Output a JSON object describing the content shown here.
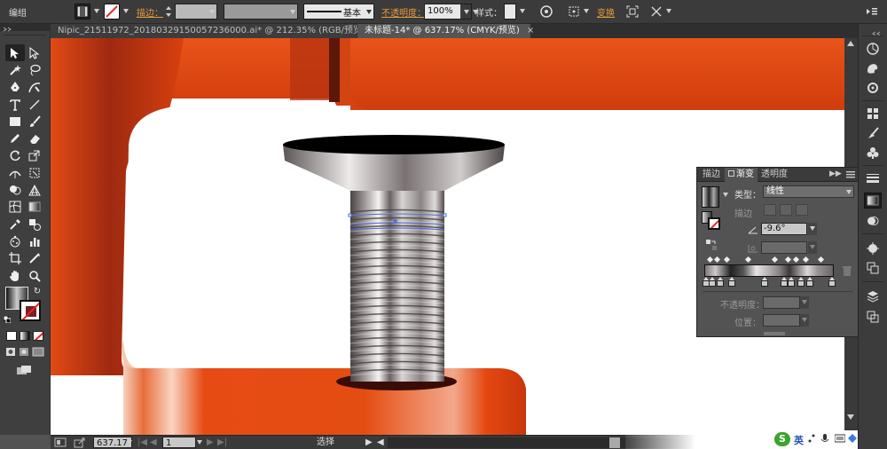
{
  "control_bar": {
    "group_label": "编组",
    "stroke_label": "描边",
    "stroke_colon": "：",
    "profile_label": "基本",
    "opacity_label": "不透明度",
    "opacity_colon": "：",
    "opacity_value": "100%",
    "style_label": "样式",
    "style_colon": "：",
    "transform_label": "变换"
  },
  "tabs": [
    {
      "label": "Nipic_21511972_20180329150057236000.ai* @ 212.35% (RGB/预览)",
      "close": "×"
    },
    {
      "label": "未标题-14* @ 637.17% (CMYK/预览)",
      "close": "×"
    }
  ],
  "status_bar": {
    "zoom": "637.17",
    "page": "1",
    "tool": "选择"
  },
  "taskbar": {
    "ime_label": "英"
  },
  "gradient_panel": {
    "tabs": [
      "描边",
      "渐变",
      "透明度"
    ],
    "type_label": "类型：",
    "type_value": "线性",
    "stroke_label": "描边",
    "angle_value": "-9.6°",
    "opacity_label": "不透明度：",
    "position_label": "位置：",
    "stop_count": 10
  },
  "colors": {
    "orange_clamp": "#e04a12",
    "accent_label": "#e79a3b",
    "panel_bg": "#535353",
    "ui_dark": "#3b3b3b"
  },
  "icons": {
    "selection": "selection-tool-icon",
    "direct_selection": "direct-selection-tool-icon",
    "magic_wand": "magic-wand-icon",
    "lasso": "lasso-icon",
    "pen": "pen-tool-icon",
    "type": "type-tool-icon",
    "hand": "hand-tool-icon",
    "zoom": "zoom-tool-icon",
    "layers": "layers-icon",
    "gradient": "gradient-panel-icon"
  }
}
